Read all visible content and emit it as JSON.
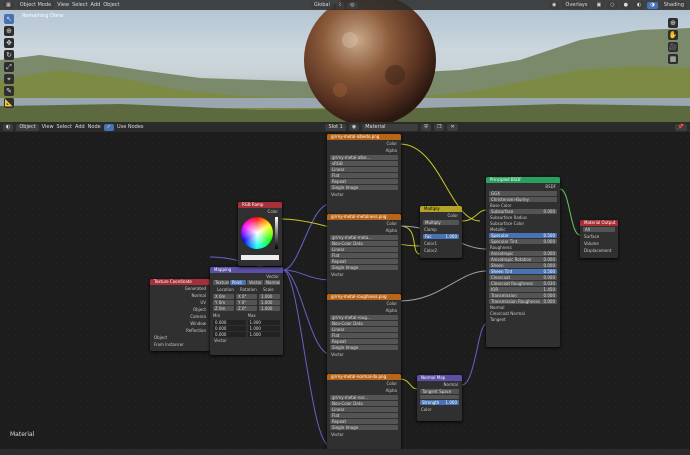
{
  "viewport": {
    "mode": "Object Mode",
    "menus": [
      "View",
      "Select",
      "Add",
      "Object"
    ],
    "transform": "Global",
    "overlay": "Overlays",
    "shading": "Shading",
    "render_status": "Remaining Done"
  },
  "editor_header": {
    "object": "Object",
    "menus": [
      "View",
      "Select",
      "Add",
      "Node"
    ],
    "use_nodes": "Use Nodes",
    "slot": "Slot 1",
    "material": "Material"
  },
  "editor_label": "Material",
  "nodes": {
    "tex1": {
      "title": "grimy-metal-albedo.png",
      "image": "grimy-metal-albe...",
      "colorspace": "sRGB",
      "interp": "Linear",
      "proj": "Flat",
      "ext": "Repeat",
      "src": "Single Image",
      "out1": "Color",
      "out2": "Alpha",
      "in": "Vector"
    },
    "tex2": {
      "title": "grimy-metal-metalness.png",
      "image": "grimy-metal-meta...",
      "colorspace": "Non-Color Data",
      "interp": "Linear",
      "proj": "Flat",
      "ext": "Repeat",
      "src": "Single Image",
      "out1": "Color",
      "out2": "Alpha",
      "in": "Vector"
    },
    "tex3": {
      "title": "grimy-metal-roughness.png",
      "image": "grimy-metal-roug...",
      "colorspace": "Non-Color Data",
      "interp": "Linear",
      "proj": "Flat",
      "ext": "Repeat",
      "src": "Single Image",
      "out1": "Color",
      "out2": "Alpha",
      "in": "Vector"
    },
    "tex4": {
      "title": "grimy-metal-normal-dx.png",
      "image": "grimy-metal-nor...",
      "colorspace": "Non-Color Data",
      "interp": "Linear",
      "proj": "Flat",
      "ext": "Repeat",
      "src": "Single Image",
      "out1": "Color",
      "out2": "Alpha",
      "in": "Vector"
    },
    "texcoord": {
      "title": "Texture Coordinate",
      "outs": [
        "Generated",
        "Normal",
        "UV",
        "Object",
        "Camera",
        "Window",
        "Reflection"
      ],
      "object_label": "Object",
      "from_instancer": "From Instancer"
    },
    "mapping": {
      "title": "Mapping",
      "out": "Vector",
      "tabs": [
        "Texture",
        "Point",
        "Vector",
        "Normal"
      ],
      "cols": [
        "Location",
        "Rotation",
        "Scale"
      ],
      "rows": [
        [
          "X 0m",
          "X 0°",
          "1.000"
        ],
        [
          "Y 0m",
          "Y 0°",
          "1.000"
        ],
        [
          "Z 0m",
          "Z 0°",
          "1.000"
        ]
      ],
      "min": "Min",
      "max": "Max",
      "minmax": [
        [
          "0.000",
          "1.000"
        ],
        [
          "0.000",
          "1.000"
        ],
        [
          "0.000",
          "1.000"
        ]
      ],
      "in": "Vector"
    },
    "rgbcurves": {
      "title": "RGB Ramp",
      "out": "Color"
    },
    "multiply": {
      "title": "Multiply",
      "out": "Color",
      "op": "Multiply",
      "clamp": "Clamp",
      "fac": "Fac",
      "fac_val": "1.000",
      "in1": "Color1",
      "in2": "Color2"
    },
    "bsdf": {
      "title": "Principled BSDF",
      "out": "BSDF",
      "dist": "GGX",
      "sss": "Christensen-Burley",
      "inputs": [
        [
          "Base Color",
          ""
        ],
        [
          "Subsurface",
          "0.000"
        ],
        [
          "Subsurface Radius",
          ""
        ],
        [
          "Subsurface Color",
          ""
        ],
        [
          "Metallic",
          ""
        ],
        [
          "Specular",
          "0.500"
        ],
        [
          "Specular Tint",
          "0.000"
        ],
        [
          "Roughness",
          ""
        ],
        [
          "Anisotropic",
          "0.000"
        ],
        [
          "Anisotropic Rotation",
          "0.000"
        ],
        [
          "Sheen",
          "0.000"
        ],
        [
          "Sheen Tint",
          "0.500"
        ],
        [
          "Clearcoat",
          "0.000"
        ],
        [
          "Clearcoat Roughness",
          "0.030"
        ],
        [
          "IOR",
          "1.450"
        ],
        [
          "Transmission",
          "0.000"
        ],
        [
          "Transmission Roughness",
          "0.000"
        ],
        [
          "Normal",
          ""
        ],
        [
          "Clearcoat Normal",
          ""
        ],
        [
          "Tangent",
          ""
        ]
      ]
    },
    "output": {
      "title": "Material Output",
      "target": "All",
      "ins": [
        "Surface",
        "Volume",
        "Displacement"
      ]
    },
    "normalmap": {
      "title": "Normal Map",
      "out": "Normal",
      "space": "Tangent Space",
      "strength": "Strength",
      "strength_val": "1.000",
      "in": "Color"
    }
  },
  "colors": {
    "tex_header": "#b8651a",
    "vec_header": "#5b4fa6",
    "input_header": "#a5303a",
    "shader_header": "#2aa060",
    "conv_header": "#b5a32a",
    "output_header": "#a72f36",
    "active_blue": "#4772b3"
  }
}
